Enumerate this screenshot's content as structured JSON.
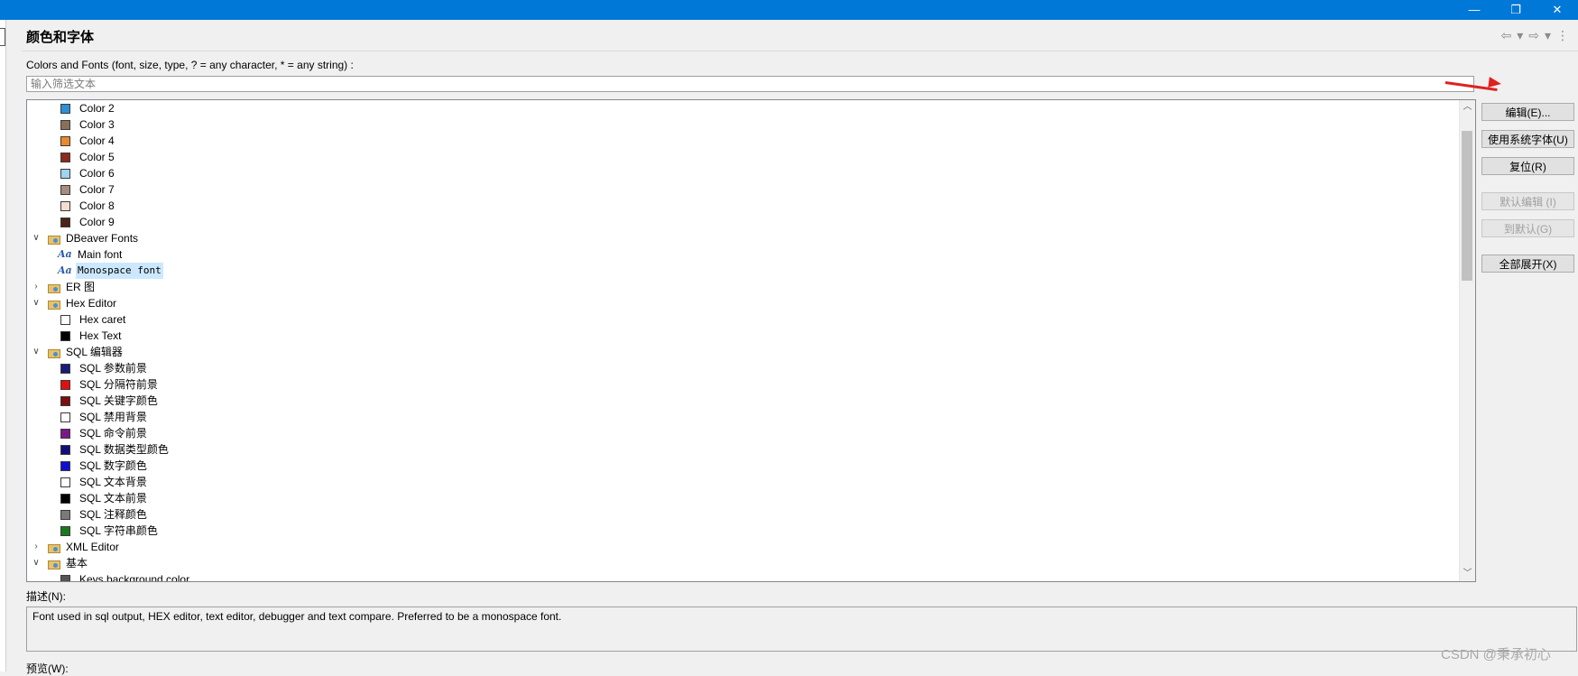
{
  "window": {
    "minimize": "—",
    "restore": "❐",
    "close": "✕"
  },
  "page": {
    "title": "颜色和字体"
  },
  "nav": {
    "back": "⇦",
    "forward": "⇨",
    "dropdown": "▾",
    "menu": "⋮"
  },
  "filter": {
    "prompt": "Colors and Fonts (font, size, type, ? = any character, * = any string) :",
    "placeholder": "输入筛选文本"
  },
  "tree": [
    {
      "type": "color",
      "label": "Color 2",
      "color": "#2f8fd6"
    },
    {
      "type": "color",
      "label": "Color 3",
      "color": "#8a6f5a"
    },
    {
      "type": "color",
      "label": "Color 4",
      "color": "#e88a2e"
    },
    {
      "type": "color",
      "label": "Color 5",
      "color": "#8b2a1e"
    },
    {
      "type": "color",
      "label": "Color 6",
      "color": "#9fd4f0"
    },
    {
      "type": "color",
      "label": "Color 7",
      "color": "#a88c7c"
    },
    {
      "type": "color",
      "label": "Color 8",
      "color": "#f6dcd0"
    },
    {
      "type": "color",
      "label": "Color 9",
      "color": "#4a2418"
    },
    {
      "type": "category",
      "label": "DBeaver Fonts",
      "expanded": true
    },
    {
      "type": "font",
      "label": "Main font"
    },
    {
      "type": "font",
      "label": "Monospace font",
      "mono": true,
      "selected": true
    },
    {
      "type": "category",
      "label": "ER 图",
      "expanded": false
    },
    {
      "type": "category",
      "label": "Hex Editor",
      "expanded": true
    },
    {
      "type": "color",
      "label": "Hex caret",
      "color": "#ffffff"
    },
    {
      "type": "color",
      "label": "Hex Text",
      "color": "#000000"
    },
    {
      "type": "category",
      "label": "SQL 编辑器",
      "expanded": true
    },
    {
      "type": "color",
      "label": "SQL 参数前景",
      "color": "#1a1a7a"
    },
    {
      "type": "color",
      "label": "SQL 分隔符前景",
      "color": "#e01010"
    },
    {
      "type": "color",
      "label": "SQL 关键字颜色",
      "color": "#7a1010"
    },
    {
      "type": "color",
      "label": "SQL 禁用背景",
      "color": "#ffffff"
    },
    {
      "type": "color",
      "label": "SQL 命令前景",
      "color": "#7a1a8a"
    },
    {
      "type": "color",
      "label": "SQL 数据类型颜色",
      "color": "#10107a"
    },
    {
      "type": "color",
      "label": "SQL 数字颜色",
      "color": "#1010d0"
    },
    {
      "type": "color",
      "label": "SQL 文本背景",
      "color": "#ffffff"
    },
    {
      "type": "color",
      "label": "SQL 文本前景",
      "color": "#000000"
    },
    {
      "type": "color",
      "label": "SQL 注释颜色",
      "color": "#7a7a7a"
    },
    {
      "type": "color",
      "label": "SQL 字符串颜色",
      "color": "#1a7a1a"
    },
    {
      "type": "category",
      "label": "XML Editor",
      "expanded": false
    },
    {
      "type": "category",
      "label": "基本",
      "expanded": true
    },
    {
      "type": "color",
      "label": "Keys background color",
      "color": "#555555"
    }
  ],
  "buttons": {
    "edit": "编辑(E)...",
    "use_system_font": "使用系统字体(U)",
    "reset": "复位(R)",
    "edit_default": "默认编辑 (I)",
    "goto_default": "到默认(G)",
    "expand_all": "全部展开(X)"
  },
  "description": {
    "label": "描述(N):",
    "text": "Font used in sql output, HEX editor, text editor, debugger and text compare. Preferred to be a monospace font."
  },
  "preview": {
    "label": "预览(W):"
  },
  "watermark": "CSDN @秉承初心"
}
